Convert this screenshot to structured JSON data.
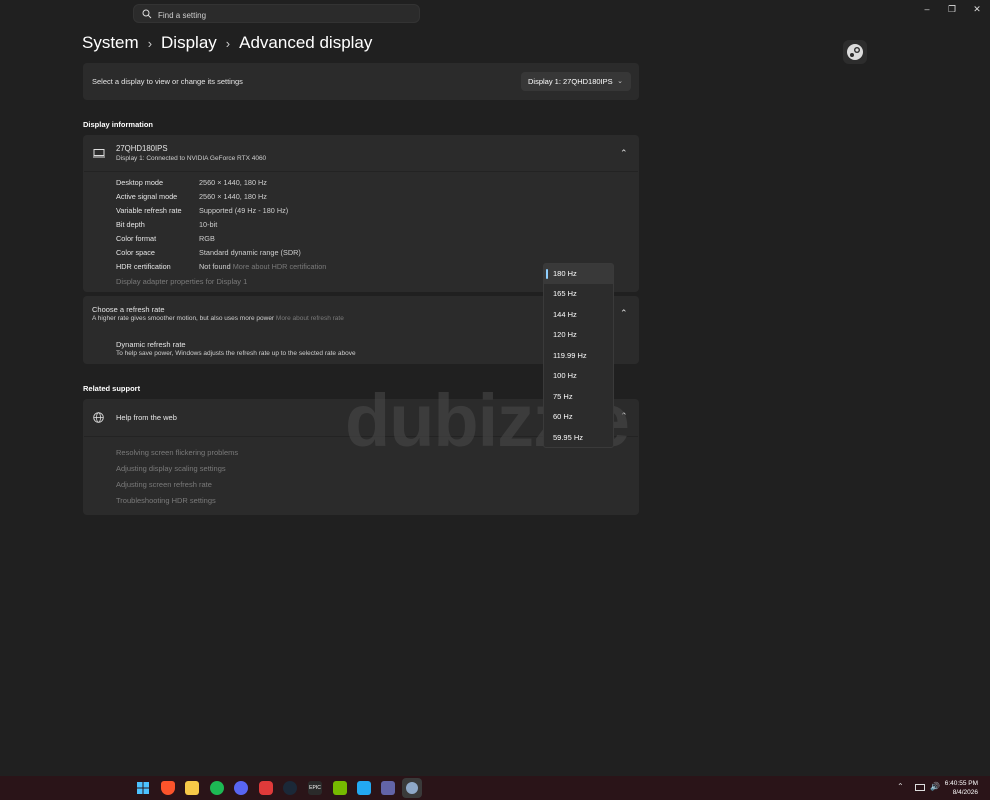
{
  "search": {
    "placeholder": "Find a setting"
  },
  "breadcrumb": {
    "part1": "System",
    "part2": "Display",
    "part3": "Advanced display"
  },
  "display_select": {
    "prompt": "Select a display to view or change its settings",
    "value": "Display 1: 27QHD180IPS"
  },
  "display_info": {
    "heading": "Display information",
    "monitor_name": "27QHD180IPS",
    "monitor_sub": "Display 1: Connected to NVIDIA GeForce RTX 4060",
    "rows": [
      {
        "label": "Desktop mode",
        "value": "2560 × 1440, 180 Hz"
      },
      {
        "label": "Active signal mode",
        "value": "2560 × 1440, 180 Hz"
      },
      {
        "label": "Variable refresh rate",
        "value": "Supported (49 Hz - 180 Hz)"
      },
      {
        "label": "Bit depth",
        "value": "10-bit"
      },
      {
        "label": "Color format",
        "value": "RGB"
      },
      {
        "label": "Color space",
        "value": "Standard dynamic range (SDR)"
      },
      {
        "label": "HDR certification",
        "value": "Not found",
        "link": "More about HDR certification"
      }
    ],
    "adapter_link": "Display adapter properties for Display 1"
  },
  "refresh": {
    "title": "Choose a refresh rate",
    "subtitle": "A higher rate gives smoother motion, but also uses more power",
    "link": "More about refresh rate",
    "dynamic_title": "Dynamic refresh rate",
    "dynamic_sub": "To help save power, Windows adjusts the refresh rate up to the selected rate above",
    "options": [
      "180 Hz",
      "165 Hz",
      "144 Hz",
      "120 Hz",
      "119.99 Hz",
      "100 Hz",
      "75 Hz",
      "60 Hz",
      "59.95 Hz"
    ],
    "selected": "180 Hz"
  },
  "support": {
    "heading": "Related support",
    "help_title": "Help from the web",
    "links": [
      "Resolving screen flickering problems",
      "Adjusting display scaling settings",
      "Adjusting screen refresh rate",
      "Troubleshooting HDR settings"
    ]
  },
  "watermark": "dubizzle",
  "taskbar": {
    "time": "6:40:55 PM",
    "date": "8/4/2026",
    "icons": [
      "windows-start",
      "brave",
      "file-explorer",
      "spotify",
      "discord",
      "app-red",
      "steam",
      "epic-games",
      "nvidia",
      "vscode",
      "teams",
      "settings"
    ],
    "epic_label": "EPIC"
  },
  "colors": {
    "background": "#202020",
    "card": "#2b2b2b",
    "accent": "#8fcfff"
  }
}
